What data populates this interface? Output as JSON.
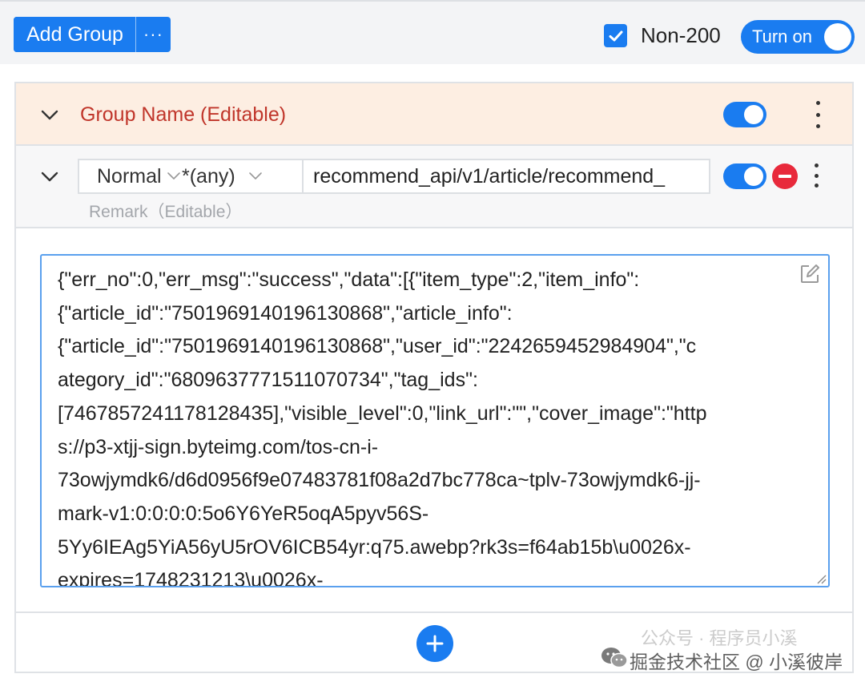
{
  "toolbar": {
    "add_group_label": "Add Group",
    "more_label": "···",
    "non200_label": "Non-200",
    "non200_checked": true,
    "master_toggle_label": "Turn on",
    "master_toggle_on": true
  },
  "group": {
    "name": "Group Name (Editable)",
    "enabled": true,
    "expanded": true
  },
  "rule": {
    "method": "Normal",
    "status": "*(any)",
    "url": "recommend_api/v1/article/recommend_",
    "remark_placeholder": "Remark（Editable）",
    "enabled": true,
    "response_body": "{\"err_no\":0,\"err_msg\":\"success\",\"data\":[{\"item_type\":2,\"item_info\":\n{\"article_id\":\"7501969140196130868\",\"article_info\":\n{\"article_id\":\"7501969140196130868\",\"user_id\":\"2242659452984904\",\"c\nategory_id\":\"6809637771511070734\",\"tag_ids\":\n[7467857241178128435],\"visible_level\":0,\"link_url\":\"\",\"cover_image\":\"http\ns://p3-xtjj-sign.byteimg.com/tos-cn-i-\n73owjymdk6/d6d0956f9e07483781f08a2d7bc778ca~tplv-73owjymdk6-jj-\nmark-v1:0:0:0:0:5o6Y6YeR5oqA5pyv56S-\n5Yy6IEAg5YiA56yU5rOV6ICB54yr:q75.awebp?rk3s=f64ab15b\\u0026x-\nexpires=1748231213\\u0026x-"
  },
  "watermark": {
    "line1": "公众号 · 程序员小溪",
    "line2": "掘金技术社区 @ 小溪彼岸"
  },
  "colors": {
    "primary": "#1a7cf0",
    "group_header_bg": "#fdeee2",
    "group_title": "#c0352a",
    "danger": "#e8293b"
  }
}
